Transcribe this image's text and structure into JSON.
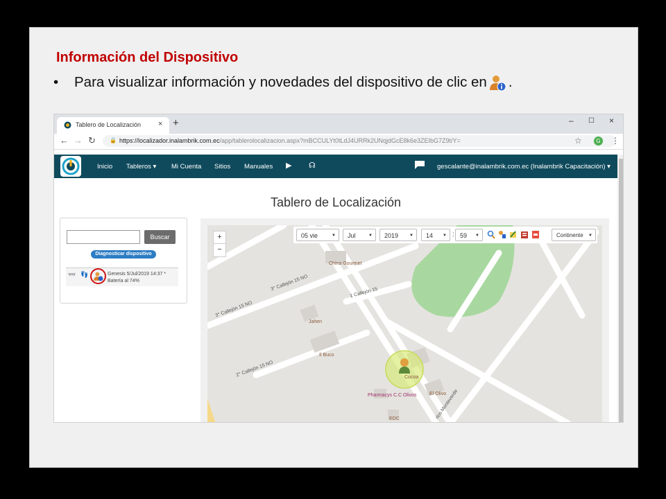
{
  "slide": {
    "title": "Información del Dispositivo",
    "bullet": "Para visualizar información y novedades del dispositivo de clic en",
    "bullet_end": ".",
    "bullet_char": "•"
  },
  "browser": {
    "tab_title": "Tablero de Localización",
    "tab_close": "×",
    "new_tab": "+",
    "url_host": "https://localizador.inalambrik.com.ec",
    "url_path": "/app/tablerolocalizacion.aspx?mBCCULYt0tLdJ4URRk2UNqjdGcE8k6e3ZEIbG7Z9t/Y=",
    "profile_letter": "G",
    "window_controls": [
      "–",
      "☐",
      "×"
    ]
  },
  "app": {
    "nav": [
      "Inicio",
      "Tableros ▾",
      "Mi Cuenta",
      "Sitios",
      "Manuales"
    ],
    "user": "gescalante@inalambrik.com.ec (Inalambrik Capacitación) ▾",
    "page_title": "Tablero de Localización"
  },
  "sidebar": {
    "search_button": "Buscar",
    "diagnose_button": "Diagnosticar dispositivo",
    "device_line1": "Genesis 5/Jul/2019 14:37 *",
    "device_line2": "Batería al 74%"
  },
  "map": {
    "zoom_in": "+",
    "zoom_out": "−",
    "day": "05 vie",
    "month": "Jul",
    "year": "2019",
    "hour": "14",
    "minute": "59",
    "time_sep": ":",
    "layer": "Continente",
    "streets": [
      "3° Callejón 15 NO",
      "3° Callejón 15 NO",
      "1 Callejón 15",
      "2° Callejón 15 NO",
      "rlos Monteverde"
    ],
    "pois": [
      "China Gourmet",
      "Jahen",
      "Il Buco",
      "Cocoa",
      "El Olivo",
      "Pharmacys C.C Olivos",
      "EDC"
    ]
  },
  "colors": {
    "title_red": "#c00000",
    "nav_bg": "#0f4a5c",
    "diag_blue": "#2d7dc4",
    "park_green": "#a8d8a0"
  }
}
